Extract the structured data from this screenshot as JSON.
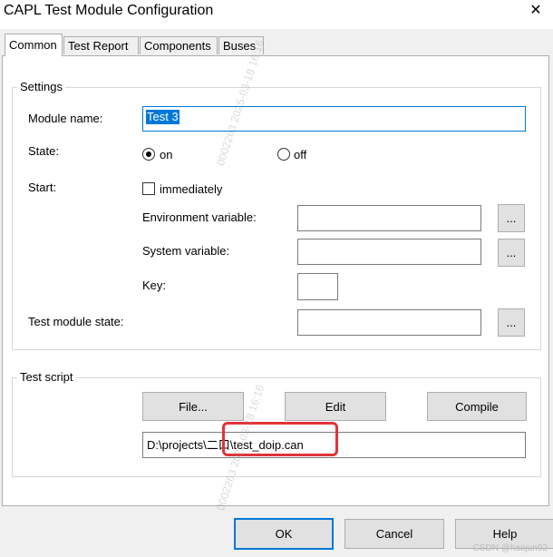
{
  "window": {
    "title": "CAPL Test Module Configuration"
  },
  "tabs": [
    {
      "label": "Common",
      "active": true
    },
    {
      "label": "Test Report",
      "active": false
    },
    {
      "label": "Components",
      "active": false
    },
    {
      "label": "Buses",
      "active": false
    }
  ],
  "settings": {
    "group_label": "Settings",
    "module_name_label": "Module name:",
    "module_name_value": "Test 3",
    "state_label": "State:",
    "state_on_label": "on",
    "state_off_label": "off",
    "state_value": "on",
    "start_label": "Start:",
    "immediately_label": "immediately",
    "immediately_checked": false,
    "env_var_label": "Environment variable:",
    "env_var_value": "",
    "sys_var_label": "System variable:",
    "sys_var_value": "",
    "key_label": "Key:",
    "key_value": "",
    "test_module_state_label": "Test module state:",
    "test_module_state_value": "",
    "browse_label": "..."
  },
  "test_script": {
    "group_label": "Test script",
    "file_button": "File...",
    "edit_button": "Edit",
    "compile_button": "Compile",
    "path_value": "D:\\projects\\二口\\test_doip.can"
  },
  "footer": {
    "ok_button": "OK",
    "cancel_button": "Cancel",
    "help_button": "Help"
  },
  "credit": "CSDN @haojun92",
  "watermark": "0002263 2025-03-18 16:16",
  "colors": {
    "accent": "#0078d7",
    "highlight": "#e0343a"
  }
}
